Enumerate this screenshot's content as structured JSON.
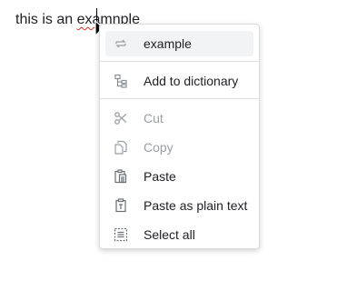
{
  "editor": {
    "text_before": "this is an ",
    "misspelled_word": "examnple"
  },
  "context_menu": {
    "suggestion": {
      "label": "example",
      "icon": "replace-icon"
    },
    "add_to_dictionary": {
      "label": "Add to dictionary",
      "icon": "dictionary-icon"
    },
    "cut": {
      "label": "Cut",
      "icon": "scissors-icon",
      "enabled": false
    },
    "copy": {
      "label": "Copy",
      "icon": "copy-icon",
      "enabled": false
    },
    "paste": {
      "label": "Paste",
      "icon": "paste-icon",
      "enabled": true
    },
    "paste_plain": {
      "label": "Paste as plain text",
      "icon": "clipboard-text-icon",
      "enabled": true
    },
    "select_all": {
      "label": "Select all",
      "icon": "select-all-icon",
      "enabled": true
    }
  },
  "colors": {
    "menu_border": "#dadce0",
    "highlight": "#f1f3f4",
    "disabled_text": "#9aa0a6",
    "spellcheck_underline": "#d93025"
  }
}
